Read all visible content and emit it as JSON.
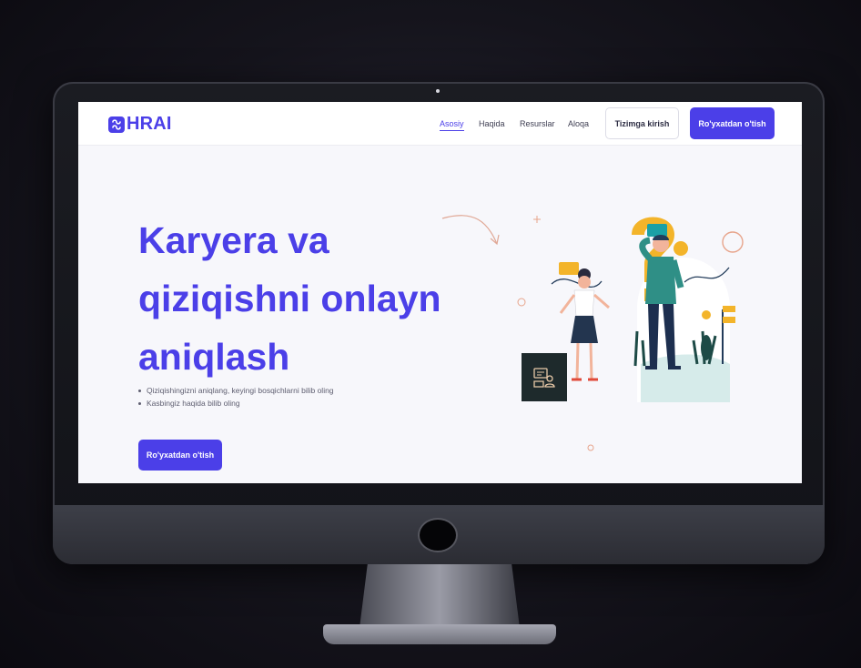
{
  "brand": {
    "name": "HRAI",
    "accent": "#4b3fe8"
  },
  "nav": {
    "links": [
      {
        "label": "Asosiy",
        "active": true
      },
      {
        "label": "Haqida",
        "active": false
      },
      {
        "label": "Resurslar",
        "active": false
      },
      {
        "label": "Aloqa",
        "active": false
      }
    ],
    "login_label": "Tizimga kirish",
    "register_label": "Ro'yxatdan o'tish"
  },
  "hero": {
    "title": "Karyera va qiziqishni onlayn aniqlash",
    "bullets": [
      "Qiziqishingizni aniqlang, keyingi bosqichlarni bilib oling",
      "Kasbingiz haqida bilib oling"
    ],
    "cta_label": "Ro'yxatdan o'tish"
  },
  "icons": {
    "logo": "hrai-logo-icon",
    "arrow": "curved-arrow-icon",
    "chat": "chat-badge-icon"
  }
}
